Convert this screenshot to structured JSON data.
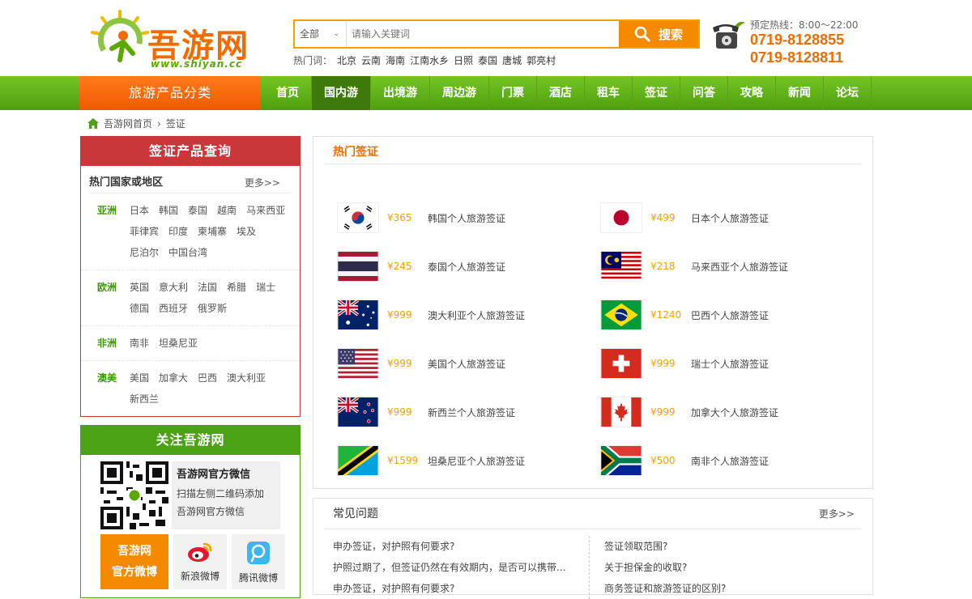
{
  "header": {
    "brand": "吾游网",
    "url": "www.shiyan.cc",
    "search": {
      "category": "全部",
      "placeholder": "请输入关键词",
      "button": "搜索"
    },
    "hot_label": "热门词：",
    "hot_words": [
      "北京",
      "云南",
      "海南",
      "江南水乡",
      "日照",
      "泰国",
      "唐城",
      "郭亮村"
    ],
    "hotline_label": "预定热线：8:00～22:00",
    "phones": [
      "0719-8128855",
      "0719-8128811"
    ]
  },
  "nav": {
    "category_title": "旅游产品分类",
    "items": [
      "首页",
      "国内游",
      "出境游",
      "周边游",
      "门票",
      "酒店",
      "租车",
      "签证",
      "问答",
      "攻略",
      "新闻",
      "论坛"
    ],
    "active_index": 1
  },
  "breadcrumb": [
    "吾游网首页",
    "签证"
  ],
  "visa_query": {
    "title": "签证产品查询",
    "hot_label": "热门国家或地区",
    "more": "更多>>",
    "regions": [
      {
        "name": "亚洲",
        "countries": [
          "日本",
          "韩国",
          "泰国",
          "越南",
          "马来西亚",
          "菲律宾",
          "印度",
          "柬埔寨",
          "埃及",
          "尼泊尔",
          "中国台湾"
        ]
      },
      {
        "name": "欧洲",
        "countries": [
          "英国",
          "意大利",
          "法国",
          "希腊",
          "瑞士",
          "德国",
          "西班牙",
          "俄罗斯"
        ]
      },
      {
        "name": "非洲",
        "countries": [
          "南非",
          "坦桑尼亚"
        ]
      },
      {
        "name": "澳美",
        "countries": [
          "美国",
          "加拿大",
          "巴西",
          "澳大利亚",
          "新西兰"
        ]
      }
    ]
  },
  "follow": {
    "title": "关注吾游网",
    "wechat_title": "吾游网官方微信",
    "wechat_desc1": "扫描左侧二维码添加",
    "wechat_desc2": "吾游网官方微信",
    "official_weibo_1": "吾游网",
    "official_weibo_2": "官方微博",
    "sina": "新浪微博",
    "tencent": "腾讯微博"
  },
  "hot_visa": {
    "title": "热门签证",
    "items": [
      {
        "flag": "kr",
        "price": "¥365",
        "name": "韩国个人旅游签证"
      },
      {
        "flag": "jp",
        "price": "¥499",
        "name": "日本个人旅游签证"
      },
      {
        "flag": "th",
        "price": "¥245",
        "name": "泰国个人旅游签证"
      },
      {
        "flag": "my",
        "price": "¥218",
        "name": "马来西亚个人旅游签证"
      },
      {
        "flag": "au",
        "price": "¥999",
        "name": "澳大利亚个人旅游签证"
      },
      {
        "flag": "br",
        "price": "¥1240",
        "name": "巴西个人旅游签证"
      },
      {
        "flag": "us",
        "price": "¥999",
        "name": "美国个人旅游签证"
      },
      {
        "flag": "ch",
        "price": "¥999",
        "name": "瑞士个人旅游签证"
      },
      {
        "flag": "nz",
        "price": "¥999",
        "name": "新西兰个人旅游签证"
      },
      {
        "flag": "ca",
        "price": "¥999",
        "name": "加拿大个人旅游签证"
      },
      {
        "flag": "tz",
        "price": "¥1599",
        "name": "坦桑尼亚个人旅游签证"
      },
      {
        "flag": "za",
        "price": "¥500",
        "name": "南非个人旅游签证"
      }
    ]
  },
  "faq": {
    "title": "常见问题",
    "more": "更多>>",
    "left": [
      "申办签证，对护照有何要求?",
      "护照过期了，但签证仍然在有效期内，是否可以携带...",
      "申办签证，对护照有何要求?"
    ],
    "right": [
      "签证领取范围?",
      "关于担保金的收取?",
      "商务签证和旅游签证的区别?"
    ]
  },
  "colors": {
    "green": "#5aa800",
    "orange": "#f26b00",
    "red": "#c9373b"
  }
}
